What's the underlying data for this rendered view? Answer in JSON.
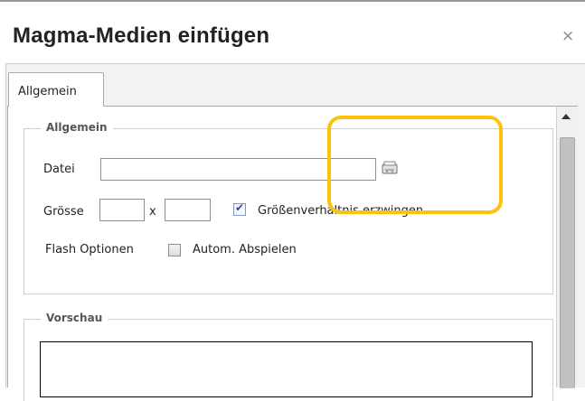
{
  "dialog": {
    "title": "Magma-Medien einfügen",
    "close_glyph": "×"
  },
  "tabs": [
    {
      "label": "Allgemein",
      "active": true
    }
  ],
  "section_general": {
    "legend": "Allgemein",
    "file_label": "Datei",
    "file_value": "",
    "browse_icon": "folder-browse-icon",
    "size_label": "Grösse",
    "width_value": "",
    "size_separator": "x",
    "height_value": "",
    "keep_ratio_label": "Größenverhältnis erzwingen",
    "keep_ratio_checked": true,
    "flash_options_label": "Flash Optionen",
    "autoplay_label": "Autom. Abspielen",
    "autoplay_checked": false
  },
  "section_preview": {
    "legend": "Vorschau"
  },
  "colors": {
    "highlight": "#fcc20e",
    "checkbox_tick": "#2a4f98"
  }
}
